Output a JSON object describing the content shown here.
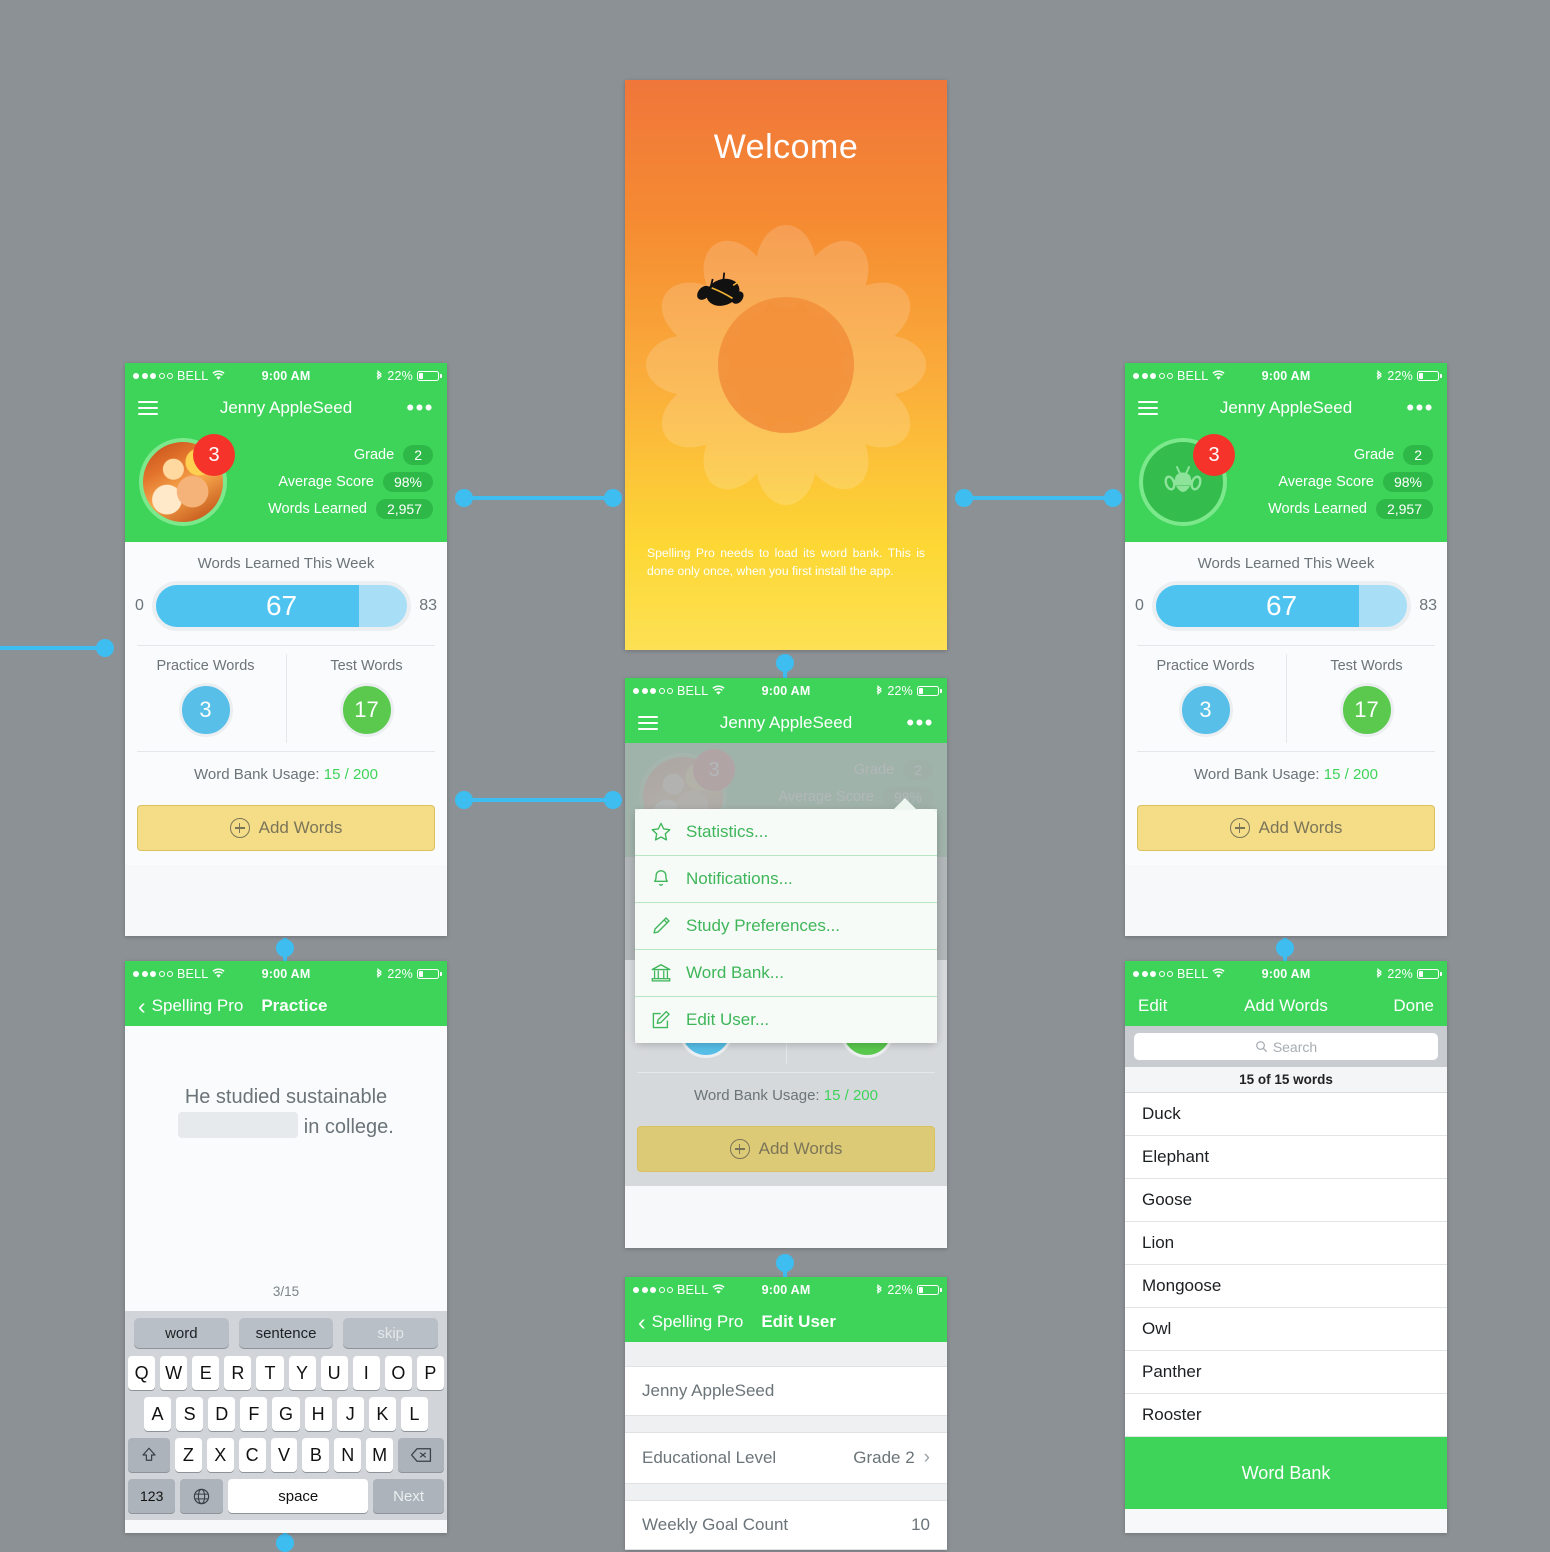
{
  "background_color": "#8c9195",
  "accent_green": "#3ed45a",
  "accent_blue": "#4ec3f0",
  "accent_yellow": "#f5dd87",
  "status_bar": {
    "carrier": "BELL",
    "time": "9:00 AM",
    "battery_percent": "22%",
    "signal_filled": 3,
    "signal_empty": 2,
    "wifi_icon": "wifi-icon",
    "bluetooth_icon": "bluetooth-icon",
    "battery_icon": "battery-icon"
  },
  "home": {
    "nav": {
      "menu_icon": "hamburger-icon",
      "title": "Jenny AppleSeed",
      "more_icon": "ellipsis-icon"
    },
    "badge_count": "3",
    "stats": [
      {
        "label": "Grade",
        "value": "2"
      },
      {
        "label": "Average Score",
        "value": "98%"
      },
      {
        "label": "Words Learned",
        "value": "2,957"
      }
    ],
    "week_title": "Words Learned This Week",
    "bar_min": "0",
    "bar_max": "83",
    "bar_value": "67",
    "bar_percent": 80.7,
    "practice": {
      "label": "Practice Words",
      "value": "3"
    },
    "test": {
      "label": "Test Words",
      "value": "17"
    },
    "usage_label": "Word Bank Usage:",
    "usage_value": "15 / 200",
    "add_words": "Add Words",
    "add_icon": "plus-circle-icon"
  },
  "welcome": {
    "title": "Welcome",
    "message": "Spelling Pro needs to load its word bank. This is done only once, when you first install the app.",
    "flower_icon": "flower-icon",
    "bee_icon": "bee-icon"
  },
  "menu": {
    "items": [
      {
        "label": "Statistics...",
        "icon": "star-icon"
      },
      {
        "label": "Notifications...",
        "icon": "bell-icon"
      },
      {
        "label": "Study Preferences...",
        "icon": "pencil-icon"
      },
      {
        "label": "Word Bank...",
        "icon": "bank-icon"
      },
      {
        "label": "Edit User...",
        "icon": "edit-square-icon"
      }
    ]
  },
  "practice": {
    "back_label": "Spelling Pro",
    "title": "Practice",
    "back_icon": "chevron-left-icon",
    "sentence_before": "He studied sustainable",
    "sentence_after": "in college.",
    "counter": "3/15",
    "suggestions": [
      {
        "label": "word",
        "dim": false
      },
      {
        "label": "sentence",
        "dim": false
      },
      {
        "label": "skip",
        "dim": true
      }
    ],
    "keyboard": {
      "row1": [
        "Q",
        "W",
        "E",
        "R",
        "T",
        "Y",
        "U",
        "I",
        "O",
        "P"
      ],
      "row2": [
        "A",
        "S",
        "D",
        "F",
        "G",
        "H",
        "J",
        "K",
        "L"
      ],
      "row3": [
        "Z",
        "X",
        "C",
        "V",
        "B",
        "N",
        "M"
      ],
      "shift_icon": "shift-icon",
      "backspace_icon": "backspace-icon",
      "numbers_key": "123",
      "globe_icon": "globe-icon",
      "space_key": "space",
      "next_key": "Next"
    }
  },
  "add_words": {
    "left_button": "Edit",
    "title": "Add Words",
    "right_button": "Done",
    "search_placeholder": "Search",
    "search_icon": "search-icon",
    "count_text": "15 of 15 words",
    "words": [
      "Duck",
      "Elephant",
      "Goose",
      "Lion",
      "Mongoose",
      "Owl",
      "Panther",
      "Rooster"
    ],
    "footer_button": "Word Bank"
  },
  "edit_user": {
    "back_label": "Spelling Pro",
    "title": "Edit User",
    "back_icon": "chevron-left-icon",
    "name": "Jenny AppleSeed",
    "rows": [
      {
        "label": "Educational Level",
        "value": "Grade 2",
        "chevron": true
      },
      {
        "label": "Weekly Goal Count",
        "value": "10",
        "chevron": false
      }
    ]
  }
}
